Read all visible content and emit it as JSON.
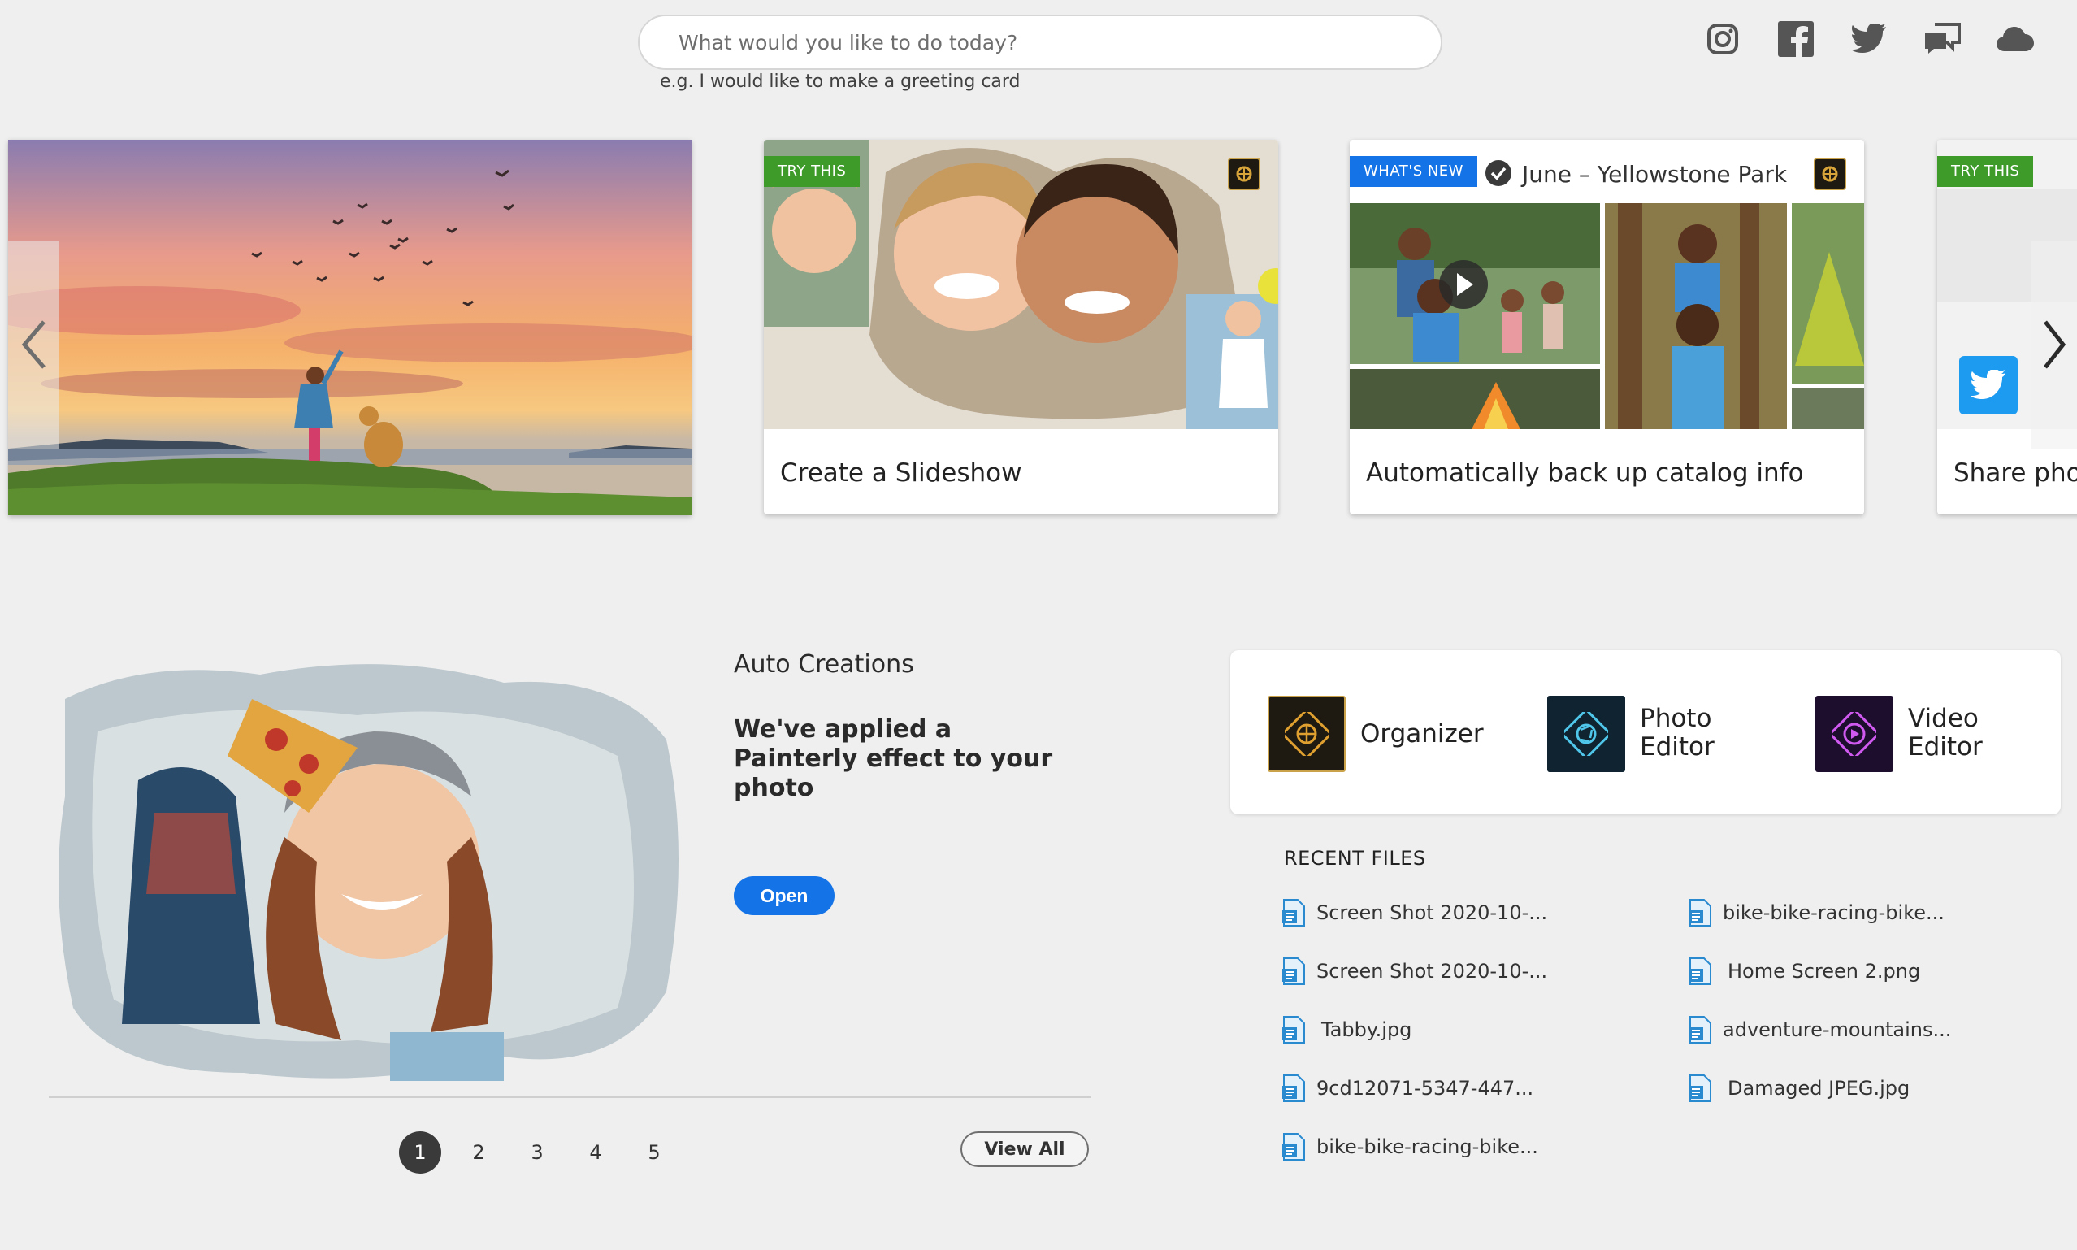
{
  "search": {
    "placeholder": "What would you like to do today?",
    "hint": "e.g. I would like to make a greeting card"
  },
  "social_icons": [
    "instagram-icon",
    "facebook-icon",
    "twitter-icon",
    "feedback-icon",
    "cloud-icon"
  ],
  "carousel": {
    "cards": [
      {
        "tag": "TRY THIS",
        "title": "Create a Slideshow"
      },
      {
        "tag": "WHAT'S NEW",
        "album": "June – Yellowstone Park",
        "title": "Automatically back up catalog info"
      },
      {
        "tag": "TRY THIS",
        "title": "Share phot"
      }
    ]
  },
  "auto_creations": {
    "label": "Auto Creations",
    "description": "We've applied a Painterly effect to your photo",
    "open_label": "Open",
    "pages": [
      "1",
      "2",
      "3",
      "4",
      "5"
    ],
    "active_page": "1",
    "view_all_label": "View All"
  },
  "apps": [
    {
      "label": "Organizer"
    },
    {
      "label": "Photo Editor"
    },
    {
      "label": "Video Editor"
    }
  ],
  "recent_files": {
    "title": "RECENT FILES",
    "left": [
      "Screen Shot 2020-10-...",
      "Screen Shot 2020-10-...",
      "Tabby.jpg",
      "9cd12071-5347-447...",
      "bike-bike-racing-bike..."
    ],
    "right": [
      "bike-bike-racing-bike...",
      "Home Screen 2.png",
      "adventure-mountains...",
      "Damaged JPEG.jpg"
    ]
  },
  "colors": {
    "accent_blue": "#1473e6",
    "tag_green": "#3e9b2a",
    "background": "#efefef"
  }
}
